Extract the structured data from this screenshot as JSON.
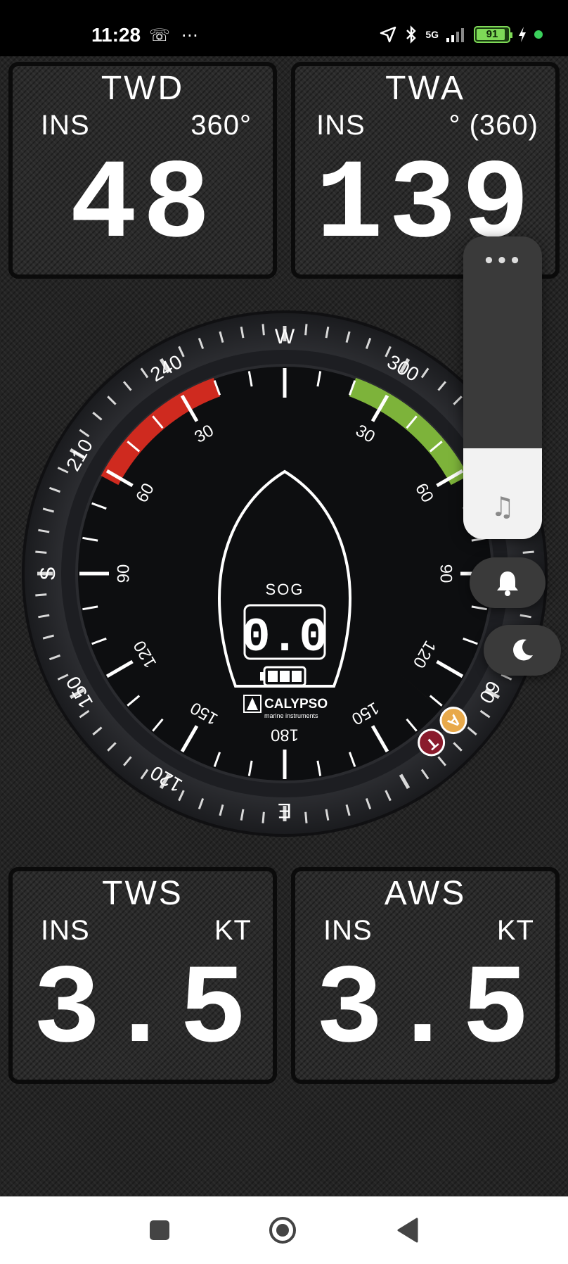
{
  "status": {
    "time": "11:28",
    "left_icons": [
      "wechat-icon",
      "more-dots-icon"
    ],
    "left_icons_text": "☏ ⋯",
    "network": "5G",
    "battery_percent": 91,
    "battery_label": "91",
    "charging": true
  },
  "panels": {
    "twd": {
      "title": "TWD",
      "source": "INS",
      "unit": "360°",
      "value": "48"
    },
    "twa": {
      "title": "TWA",
      "source": "INS",
      "unit": "° (360)",
      "value": "139"
    },
    "tws": {
      "title": "TWS",
      "source": "INS",
      "unit": "KT",
      "value": "3.5"
    },
    "aws": {
      "title": "AWS",
      "source": "INS",
      "unit": "KT",
      "value": "3.5"
    }
  },
  "compass": {
    "cardinals": {
      "top": "W",
      "left": "S",
      "bottom": "E"
    },
    "outer_labels": [
      "240",
      "210",
      "150",
      "120",
      "300",
      "30",
      "60"
    ],
    "inner_labels": [
      "30",
      "60",
      "90",
      "120",
      "150",
      "180"
    ],
    "sog_label": "SOG",
    "sog_value": "0.0",
    "brand": "CALYPSO",
    "brand_sub": "marine instruments",
    "apparent_marker": "A",
    "true_marker": "T",
    "red_sector_color": "#cf2a1f",
    "green_sector_color": "#7db33a",
    "apparent_needle_color": "#e8a94a",
    "true_needle_color": "#8a1b2c",
    "true_wind_angle_deg": 139
  },
  "overlay": {
    "volume_level": 0.3,
    "more_label": "•••",
    "music_icon": "♫",
    "bell_icon": "bell-icon",
    "moon_icon": "moon-icon"
  },
  "tabs": [
    "menu-icon",
    "compass-icon",
    "map-icon",
    "list-icon",
    "grid-icon"
  ],
  "navbar": [
    "recents-button",
    "home-button",
    "back-button"
  ]
}
